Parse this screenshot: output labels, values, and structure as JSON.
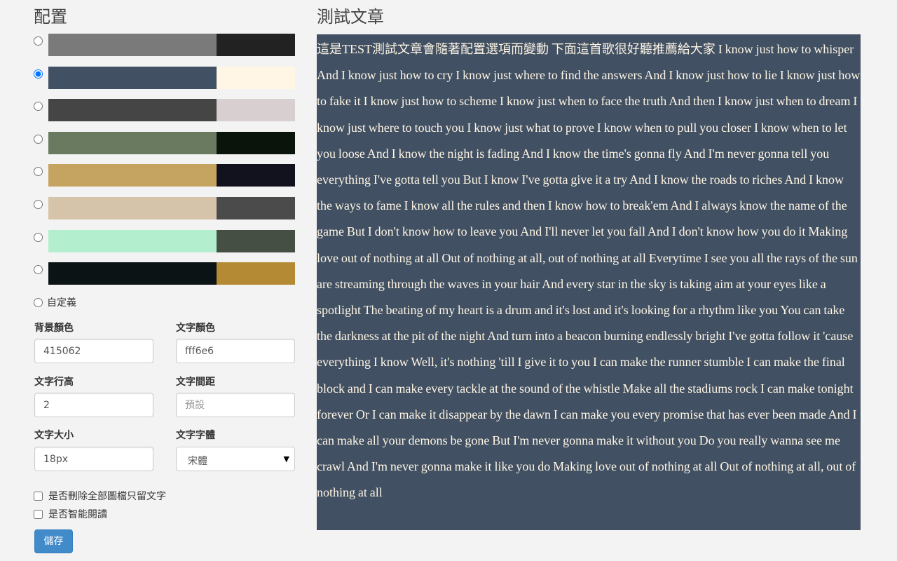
{
  "settings": {
    "title": "配置",
    "themes": [
      {
        "bg": "#7a7a7a",
        "fg": "#222222",
        "selected": false
      },
      {
        "bg": "#415062",
        "fg": "#fff6e6",
        "selected": true
      },
      {
        "bg": "#444544",
        "fg": "#d8d0d0",
        "selected": false
      },
      {
        "bg": "#6a7a60",
        "fg": "#0a140a",
        "selected": false
      },
      {
        "bg": "#c4a460",
        "fg": "#12121f",
        "selected": false
      },
      {
        "bg": "#d5c4aa",
        "fg": "#4b4b4b",
        "selected": false
      },
      {
        "bg": "#b3eecf",
        "fg": "#454f44",
        "selected": false
      },
      {
        "bg": "#0b1315",
        "fg": "#b48a34",
        "selected": false
      }
    ],
    "custom_label": "自定義",
    "bg_color_label": "背景顏色",
    "bg_color_value": "415062",
    "text_color_label": "文字顏色",
    "text_color_value": "fff6e6",
    "line_height_label": "文字行高",
    "line_height_value": "2",
    "letter_spacing_label": "文字間距",
    "letter_spacing_placeholder": "預設",
    "font_size_label": "文字大小",
    "font_size_value": "18px",
    "font_family_label": "文字字體",
    "font_family_value": "宋體",
    "remove_extra_label": "是否刪除全部圖檔只留文字",
    "smart_read_label": "是否智能閱讀",
    "save_label": "儲存"
  },
  "preview": {
    "title": "測試文章",
    "bg_color": "#415062",
    "text_color": "#fff6e6",
    "text": "這是TEST測試文章會隨著配置選項而變動 下面這首歌很好聽推薦給大家 I know just how to whisper And I know just how to cry I know just where to find the answers And I know just how to lie I know just how to fake it I know just how to scheme I know just when to face the truth And then I know just when to dream I know just where to touch you I know just what to prove I know when to pull you closer I know when to let you loose And I know the night is fading And I know the time's gonna fly And I'm never gonna tell you everything I've gotta tell you But I know I've gotta give it a try And I know the roads to riches And I know the ways to fame I know all the rules and then I know how to break'em And I always know the name of the game But I don't know how to leave you And I'll never let you fall And I don't know how you do it Making love out of nothing at all Out of nothing at all, out of nothing at all Everytime I see you all the rays of the sun are streaming through the waves in your hair And every star in the sky is taking aim at your eyes like a spotlight The beating of my heart is a drum and it's lost and it's looking for a rhythm like you You can take the darkness at the pit of the night And turn into a beacon burning endlessly bright I've gotta follow it 'cause everything I know Well, it's nothing 'till I give it to you I can make the runner stumble I can make the final block and I can make every tackle at the sound of the whistle Make all the stadiums rock I can make tonight forever Or I can make it disappear by the dawn I can make you every promise that has ever been made And I can make all your demons be gone But I'm never gonna make it without you Do you really wanna see me crawl And I'm never gonna make it like you do Making love out of nothing at all Out of nothing at all, out of nothing at all"
  }
}
